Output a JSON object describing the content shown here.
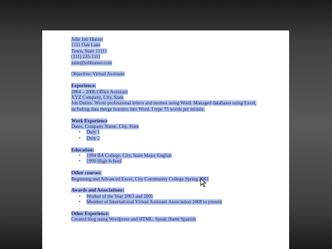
{
  "resume": {
    "contact": [
      "Julie Job Hunter",
      "1111 Oak Lane",
      "Town, State 11111",
      "(111) 235-1111",
      "julie@jobhunter.com"
    ],
    "objective": "Objective: Virtual Assistant",
    "experience": {
      "heading": "Experience:",
      "lines": [
        "2004 – 2006 Office Assistant",
        "XYZ Company, City, State",
        "Job Duties: Wrote professional letters and memos using Word. Managed databases using Excel,",
        "including data merge features into Word. I type 75 words per minute."
      ]
    },
    "work_experience": {
      "heading": "Work Experience",
      "subline": "Dates, Company Name, City, State",
      "duties": [
        "Duty 1",
        "Duty 2"
      ]
    },
    "education": {
      "heading": "Education:",
      "items": [
        "1994 BA College, City, State Major English",
        "1990 High School"
      ]
    },
    "other_courses": {
      "heading": "Other courses:",
      "line": "Beginning and Advanced Excel, City Community College Spring 2001"
    },
    "awards": {
      "heading": "Awards and Associations:",
      "items": [
        "Worker of the Year 2003 and 2005",
        "Member of International Virtual Assistant Association 2008 to present"
      ]
    },
    "other_experience": {
      "heading": "Other Experience:",
      "line": "Created blog using Wordpress and HTML. Speak fluent Spanish"
    }
  },
  "colors": {
    "selection_highlight": "#b5c7ee",
    "text": "#1b1b6a"
  }
}
